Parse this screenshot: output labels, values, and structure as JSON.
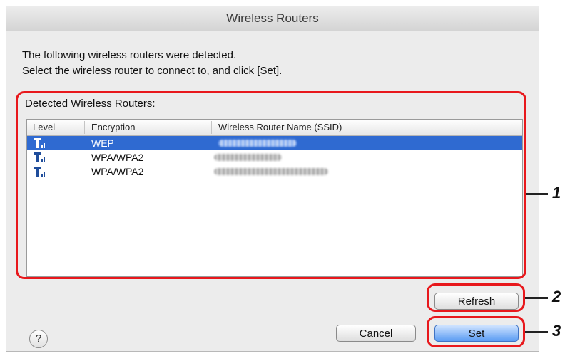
{
  "window": {
    "title": "Wireless Routers"
  },
  "intro": {
    "line1": "The following wireless routers were detected.",
    "line2": "Select the wireless router to connect to, and click [Set]."
  },
  "list": {
    "label": "Detected Wireless Routers:",
    "columns": {
      "level": "Level",
      "encryption": "Encryption",
      "ssid": "Wireless Router Name (SSID)"
    },
    "rows": [
      {
        "encryption": "WEP",
        "selected": true,
        "level_icon": "signal-strength-icon"
      },
      {
        "encryption": "WPA/WPA2",
        "selected": false,
        "level_icon": "signal-strength-icon"
      },
      {
        "encryption": "WPA/WPA2",
        "selected": false,
        "level_icon": "signal-strength-icon"
      }
    ]
  },
  "buttons": {
    "refresh": "Refresh",
    "cancel": "Cancel",
    "set": "Set",
    "help": "?"
  },
  "callouts": {
    "one": "1",
    "two": "2",
    "three": "3"
  },
  "colors": {
    "selection": "#2f6ad1",
    "callout": "#e8181c"
  }
}
